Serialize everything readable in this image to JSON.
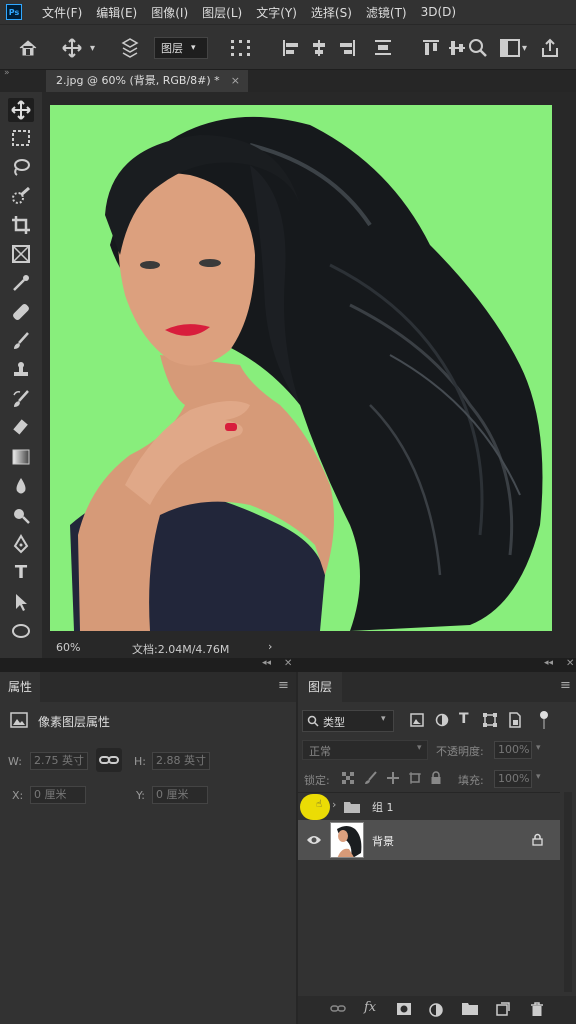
{
  "menu": {
    "app_logo": "Ps",
    "items": [
      "文件(F)",
      "编辑(E)",
      "图像(I)",
      "图层(L)",
      "文字(Y)",
      "选择(S)",
      "滤镜(T)",
      "3D(D)"
    ]
  },
  "options_bar": {
    "auto_select_value": "图层"
  },
  "document_tab": {
    "title": "2.jpg @ 60% (背景, RGB/8#) *",
    "close": "×"
  },
  "toolbar": {
    "tools": [
      "move-tool",
      "marquee-tool",
      "lasso-tool",
      "quick-select-tool",
      "crop-tool",
      "frame-tool",
      "eyedropper-tool",
      "healing-brush-tool",
      "brush-tool",
      "clone-stamp-tool",
      "history-brush-tool",
      "eraser-tool",
      "gradient-tool",
      "blur-tool",
      "dodge-tool",
      "pen-tool",
      "type-tool",
      "path-select-tool",
      "ellipse-tool"
    ],
    "type_glyph": "T"
  },
  "status_bar": {
    "zoom": "60%",
    "doc_info": "文档:2.04M/4.76M",
    "arrow": "›"
  },
  "properties_panel": {
    "tab_label": "属性",
    "header": "像素图层属性",
    "w_label": "W:",
    "w_value": "2.75 英寸",
    "h_label": "H:",
    "h_value": "2.88 英寸",
    "x_label": "X:",
    "x_value": "0 厘米",
    "y_label": "Y:",
    "y_value": "0 厘米"
  },
  "layers_panel": {
    "tab_label": "图层",
    "filter_label": "类型",
    "blend_mode": "正常",
    "opacity_label": "不透明度:",
    "opacity_value": "100%",
    "lock_label": "锁定:",
    "fill_label": "填充:",
    "fill_value": "100%",
    "layers": [
      {
        "name": "组 1",
        "type": "group",
        "visible": false
      },
      {
        "name": "背景",
        "type": "pixel",
        "visible": true,
        "locked": true,
        "selected": true
      }
    ]
  },
  "colors": {
    "canvas_bg": "#88ee7c",
    "panel_bg": "#323232",
    "cursor_highlight": "#ffee00"
  }
}
